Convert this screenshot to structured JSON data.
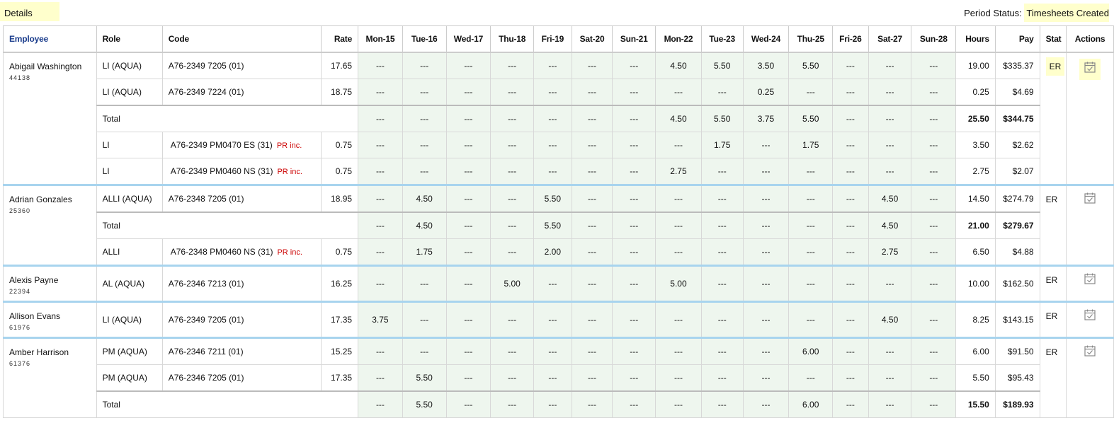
{
  "header": {
    "details_label": "Details",
    "period_status_label": "Period Status:",
    "period_status_value": "Timesheets Created"
  },
  "columns": [
    "Employee",
    "Role",
    "Code",
    "Rate",
    "Mon-15",
    "Tue-16",
    "Wed-17",
    "Thu-18",
    "Fri-19",
    "Sat-20",
    "Sun-21",
    "Mon-22",
    "Tue-23",
    "Wed-24",
    "Thu-25",
    "Fri-26",
    "Sat-27",
    "Sun-28",
    "Hours",
    "Pay",
    "Stat",
    "Actions"
  ],
  "employees": [
    {
      "name": "Abigail Washington",
      "id": "44138",
      "stat": "ER",
      "rows": [
        {
          "role": "LI (AQUA)",
          "code": "A76-2349 7205 (01)",
          "rate": "17.65",
          "days": [
            "---",
            "---",
            "---",
            "---",
            "---",
            "---",
            "---",
            "4.50",
            "5.50",
            "3.50",
            "5.50",
            "---",
            "---",
            "---"
          ],
          "hours": "19.00",
          "pay": "$335.37"
        },
        {
          "role": "LI (AQUA)",
          "code": "A76-2349 7224 (01)",
          "rate": "18.75",
          "days": [
            "---",
            "---",
            "---",
            "---",
            "---",
            "---",
            "---",
            "---",
            "---",
            "0.25",
            "---",
            "---",
            "---",
            "---"
          ],
          "hours": "0.25",
          "pay": "$4.69"
        },
        {
          "total": true,
          "label": "Total",
          "days": [
            "---",
            "---",
            "---",
            "---",
            "---",
            "---",
            "---",
            "4.50",
            "5.50",
            "3.75",
            "5.50",
            "---",
            "---",
            "---"
          ],
          "hours": "25.50",
          "pay": "$344.75"
        },
        {
          "role": "LI",
          "code": "A76-2349 PM0470 ES (31)",
          "pr": "PR inc.",
          "rate": "0.75",
          "days": [
            "---",
            "---",
            "---",
            "---",
            "---",
            "---",
            "---",
            "---",
            "1.75",
            "---",
            "1.75",
            "---",
            "---",
            "---"
          ],
          "hours": "3.50",
          "pay": "$2.62"
        },
        {
          "role": "LI",
          "code": "A76-2349 PM0460 NS (31)",
          "pr": "PR inc.",
          "rate": "0.75",
          "days": [
            "---",
            "---",
            "---",
            "---",
            "---",
            "---",
            "---",
            "2.75",
            "---",
            "---",
            "---",
            "---",
            "---",
            "---"
          ],
          "hours": "2.75",
          "pay": "$2.07"
        }
      ]
    },
    {
      "name": "Adrian Gonzales",
      "id": "25360",
      "stat": "ER",
      "rows": [
        {
          "role": "ALLI (AQUA)",
          "code": "A76-2348 7205 (01)",
          "rate": "18.95",
          "days": [
            "---",
            "4.50",
            "---",
            "---",
            "5.50",
            "---",
            "---",
            "---",
            "---",
            "---",
            "---",
            "---",
            "4.50",
            "---"
          ],
          "hours": "14.50",
          "pay": "$274.79"
        },
        {
          "total": true,
          "label": "Total",
          "days": [
            "---",
            "4.50",
            "---",
            "---",
            "5.50",
            "---",
            "---",
            "---",
            "---",
            "---",
            "---",
            "---",
            "4.50",
            "---"
          ],
          "hours": "21.00",
          "pay": "$279.67"
        },
        {
          "role": "ALLI",
          "code": "A76-2348 PM0460 NS (31)",
          "pr": "PR inc.",
          "rate": "0.75",
          "days": [
            "---",
            "1.75",
            "---",
            "---",
            "2.00",
            "---",
            "---",
            "---",
            "---",
            "---",
            "---",
            "---",
            "2.75",
            "---"
          ],
          "hours": "6.50",
          "pay": "$4.88"
        }
      ]
    },
    {
      "name": "Alexis Payne",
      "id": "22394",
      "stat": "ER",
      "rows": [
        {
          "role": "AL (AQUA)",
          "code": "A76-2346 7213 (01)",
          "rate": "16.25",
          "days": [
            "---",
            "---",
            "---",
            "5.00",
            "---",
            "---",
            "---",
            "5.00",
            "---",
            "---",
            "---",
            "---",
            "---",
            "---"
          ],
          "hours": "10.00",
          "pay": "$162.50"
        }
      ]
    },
    {
      "name": "Allison Evans",
      "id": "61976",
      "stat": "ER",
      "rows": [
        {
          "role": "LI (AQUA)",
          "code": "A76-2349 7205 (01)",
          "rate": "17.35",
          "days": [
            "3.75",
            "---",
            "---",
            "---",
            "---",
            "---",
            "---",
            "---",
            "---",
            "---",
            "---",
            "---",
            "4.50",
            "---"
          ],
          "hours": "8.25",
          "pay": "$143.15"
        }
      ]
    },
    {
      "name": "Amber Harrison",
      "id": "61376",
      "stat": "ER",
      "rows": [
        {
          "role": "PM (AQUA)",
          "code": "A76-2346 7211 (01)",
          "rate": "15.25",
          "days": [
            "---",
            "---",
            "---",
            "---",
            "---",
            "---",
            "---",
            "---",
            "---",
            "---",
            "6.00",
            "---",
            "---",
            "---"
          ],
          "hours": "6.00",
          "pay": "$91.50"
        },
        {
          "role": "PM (AQUA)",
          "code": "A76-2346 7205 (01)",
          "rate": "17.35",
          "days": [
            "---",
            "5.50",
            "---",
            "---",
            "---",
            "---",
            "---",
            "---",
            "---",
            "---",
            "---",
            "---",
            "---",
            "---"
          ],
          "hours": "5.50",
          "pay": "$95.43"
        },
        {
          "total": true,
          "label": "Total",
          "days": [
            "---",
            "5.50",
            "---",
            "---",
            "---",
            "---",
            "---",
            "---",
            "---",
            "---",
            "6.00",
            "---",
            "---",
            "---"
          ],
          "hours": "15.50",
          "pay": "$189.93"
        }
      ]
    }
  ],
  "icons": {
    "action": "calendar-check-icon"
  },
  "colors": {
    "highlight": "#ffffcc",
    "day_bg": "#eef6ee",
    "group_border": "#a8d4ee",
    "pr_red": "#cc0000",
    "header_blue": "#1a3c8c"
  }
}
